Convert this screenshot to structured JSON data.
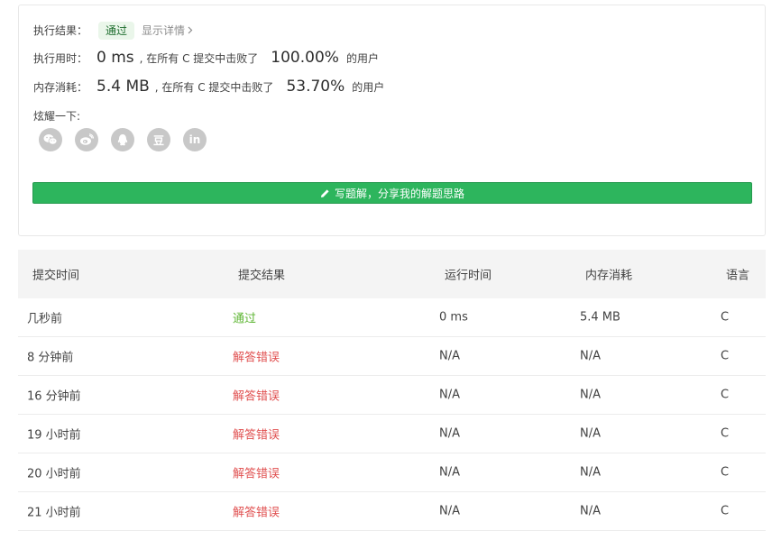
{
  "result": {
    "result_label": "执行结果：",
    "status": "通过",
    "detail_link": "显示详情",
    "runtime_label": "执行用时：",
    "runtime_value": "0 ms",
    "runtime_sep": ", 在所有 C 提交中击败了",
    "runtime_pct": "100.00%",
    "runtime_suffix": "的用户",
    "memory_label": "内存消耗：",
    "memory_value": "5.4 MB",
    "memory_sep": ", 在所有 C 提交中击败了",
    "memory_pct": "53.70%",
    "memory_suffix": "的用户",
    "share_label": "炫耀一下:",
    "share_icons": [
      "wechat-icon",
      "weibo-icon",
      "qq-icon",
      "douban-icon",
      "linkedin-icon"
    ],
    "douban_glyph": "豆",
    "linkedin_glyph": "in"
  },
  "solution_button_label": "写题解，分享我的解题思路",
  "table": {
    "headers": [
      "提交时间",
      "提交结果",
      "运行时间",
      "内存消耗",
      "语言"
    ],
    "rows": [
      {
        "time": "几秒前",
        "result": "通过",
        "runtime": "0 ms",
        "memory": "5.4 MB",
        "language": "C"
      },
      {
        "time": "8 分钟前",
        "result": "解答错误",
        "runtime": "N/A",
        "memory": "N/A",
        "language": "C"
      },
      {
        "time": "16 分钟前",
        "result": "解答错误",
        "runtime": "N/A",
        "memory": "N/A",
        "language": "C"
      },
      {
        "time": "19 小时前",
        "result": "解答错误",
        "runtime": "N/A",
        "memory": "N/A",
        "language": "C"
      },
      {
        "time": "20 小时前",
        "result": "解答错误",
        "runtime": "N/A",
        "memory": "N/A",
        "language": "C"
      },
      {
        "time": "21 小时前",
        "result": "解答错误",
        "runtime": "N/A",
        "memory": "N/A",
        "language": "C"
      }
    ]
  },
  "colors": {
    "accepted": "#5cb531",
    "wrong": "#e05050",
    "button": "#2db55d",
    "icon_bg": "#c8c8c8"
  }
}
